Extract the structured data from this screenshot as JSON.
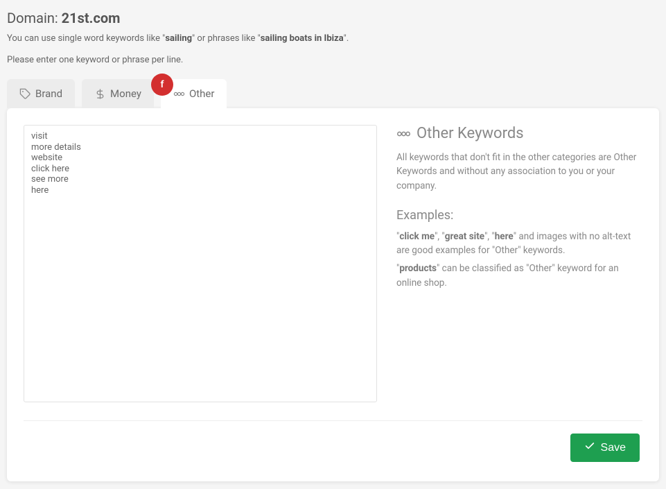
{
  "header": {
    "prefix": "Domain:",
    "domain_name": "21st.com"
  },
  "intro": {
    "part1": "You can use single word keywords like \"",
    "bold1": "sailing",
    "part2": "\" or phrases like \"",
    "bold2": "sailing boats in Ibiza",
    "part3": "\"."
  },
  "instruction": "Please enter one keyword or phrase per line.",
  "tabs": {
    "brand": "Brand",
    "money": "Money",
    "other": "Other"
  },
  "textarea_value": "visit\nmore details\nwebsite\nclick here\nsee more\nhere",
  "panel": {
    "title": "Other Keywords",
    "desc": "All keywords that don't fit in the other categories are Other Keywords and without any association to you or your company.",
    "examples_heading": "Examples:",
    "ex1_q1": "\"",
    "ex1_b1": "click me",
    "ex1_q2": "\", \"",
    "ex1_b2": "great site",
    "ex1_q3": "\", \"",
    "ex1_b3": "here",
    "ex1_tail": "\" and images with no alt-text are good examples for \"Other\" keywords.",
    "ex2_q1": "\"",
    "ex2_b1": "products",
    "ex2_tail": "\" can be classified as \"Other\" keyword for an online shop."
  },
  "save_label": "Save",
  "annotation_badge": "f"
}
